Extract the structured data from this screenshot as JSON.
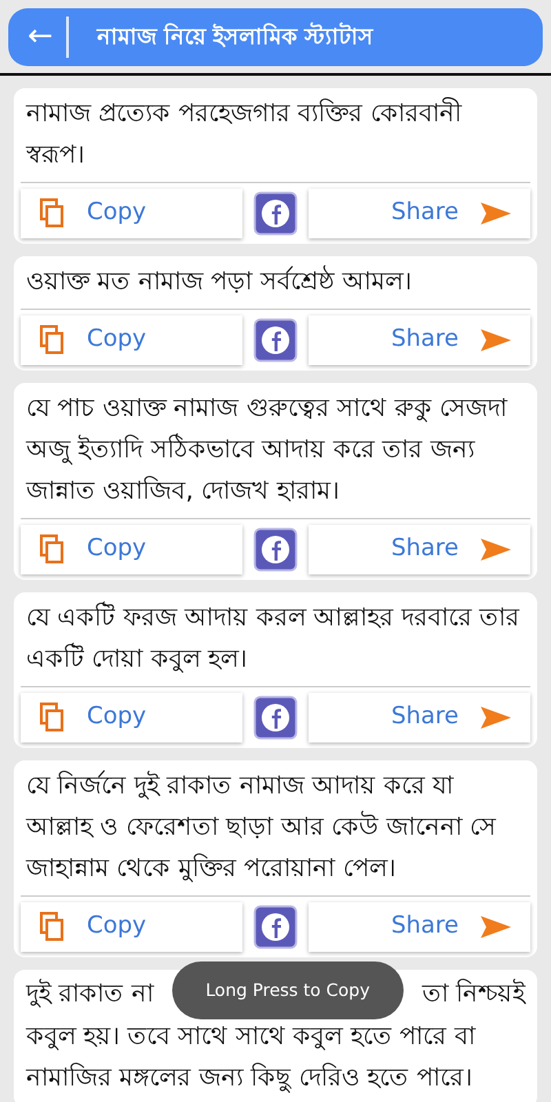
{
  "app_bar": {
    "back_icon": "←",
    "title": "নামাজ নিয়ে ইসলামিক স্ট্যাটাস"
  },
  "cards": [
    {
      "text": "নামাজ প্রত্যেক পরহেজগার ব্যক্তির কোরবানী স্বরূপ।",
      "copy_label": "Copy",
      "share_label": "Share"
    },
    {
      "text": "ওয়াক্ত মত নামাজ পড়া সর্বশ্রেষ্ঠ আমল।",
      "copy_label": "Copy",
      "share_label": "Share"
    },
    {
      "text": "যে পাচ ওয়াক্ত নামাজ গুরুত্বের সাথে রুকু সেজদা অজু ইত্যাদি সঠিকভাবে আদায় করে তার জন্য জান্নাত ওয়াজিব, দোজখ হারাম।",
      "copy_label": "Copy",
      "share_label": "Share"
    },
    {
      "text": "যে একটি ফরজ আদায় করল আল্লাহর দরবারে তার একটি দোয়া কবুল হল।",
      "copy_label": "Copy",
      "share_label": "Share"
    },
    {
      "text": "যে নির্জনে দুই রাকাত নামাজ আদায় করে যা আল্লাহ ও ফেরেশতা ছাড়া আর কেউ জানেনা সে জাহান্নাম থেকে মুক্তির পরোয়ানা পেল।",
      "copy_label": "Copy",
      "share_label": "Share"
    },
    {
      "text_parts": [
        "দুই রাকাত না",
        "তা নিশ্চয়ই",
        "কবুল হয়। তবে সাথে সাথে কবুল হতে পারে বা নামাজির মঙ্গলের জন্য কিছু দেরিও হতে পারে।"
      ]
    }
  ],
  "toast": "Long Press to Copy"
}
